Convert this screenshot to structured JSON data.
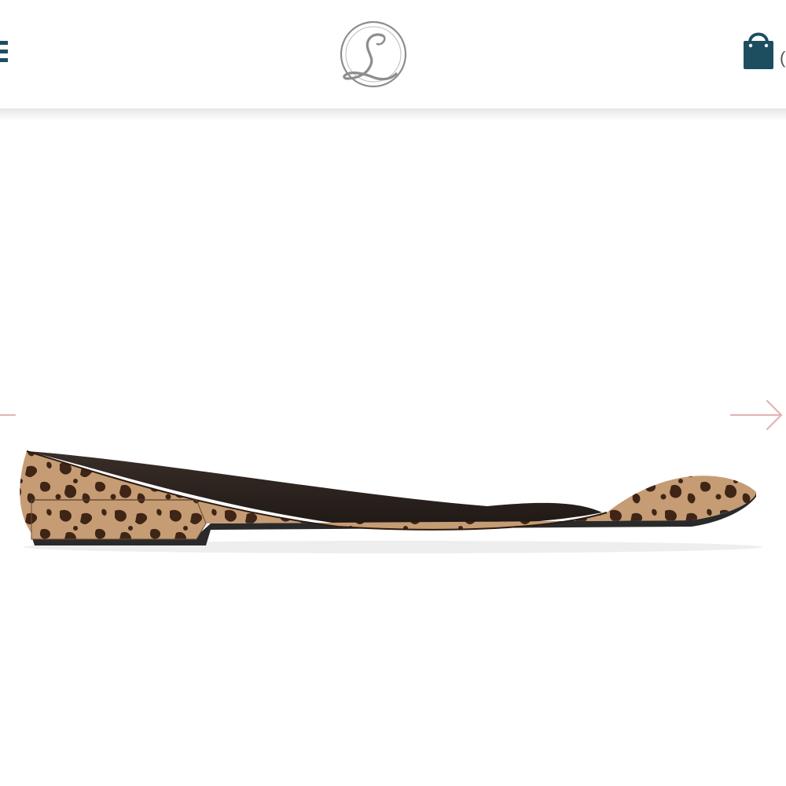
{
  "header": {
    "menu_icon": "hamburger-menu-icon",
    "logo_icon": "script-L-monogram-logo",
    "cart_icon": "shopping-bag-icon",
    "cart_count": "("
  },
  "carousel": {
    "prev_icon": "arrow-left-icon",
    "next_icon": "arrow-right-icon",
    "image": "leopard-print-pointed-toe-flat-shoe"
  },
  "colors": {
    "brand": "#1d4e60",
    "arrow": "#e3b3b3",
    "leopard_base": "#c69c74",
    "leopard_spot": "#3e2516",
    "sole": "#2a2a2a"
  }
}
